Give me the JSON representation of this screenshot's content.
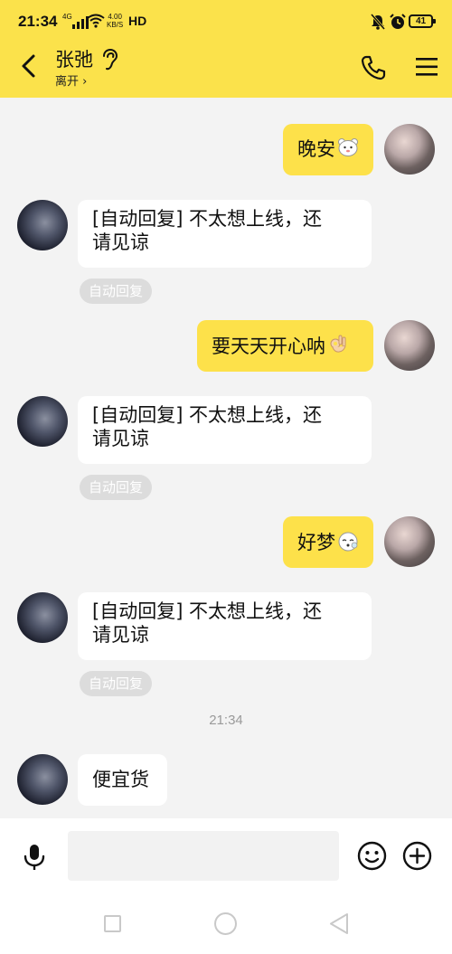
{
  "status_bar": {
    "time": "21:34",
    "network": "4G",
    "speed_value": "4.00",
    "speed_unit": "KB/S",
    "hd": "HD",
    "battery": "41"
  },
  "header": {
    "contact_name": "张弛",
    "contact_status": "离开 ›",
    "icons": [
      "back-arrow-icon",
      "ear-icon",
      "phone-icon",
      "menu-icon"
    ]
  },
  "messages": [
    {
      "side": "me",
      "text": "晚安",
      "emoji": "bear-emoji"
    },
    {
      "side": "them",
      "line1": "[自动回复] 不太想上线，还",
      "line2": "请见谅",
      "tag": "自动回复"
    },
    {
      "side": "me",
      "text": "要天天开心呐",
      "emoji": "ok-hand-emoji"
    },
    {
      "side": "them",
      "line1": "[自动回复] 不太想上线，还",
      "line2": "请见谅",
      "tag": "自动回复"
    },
    {
      "side": "me",
      "text": "好梦",
      "emoji": "sleepy-emoji"
    },
    {
      "side": "them",
      "line1": "[自动回复] 不太想上线，还",
      "line2": "请见谅",
      "tag": "自动回复"
    },
    {
      "timestamp": "21:34"
    },
    {
      "side": "them",
      "text": "便宜货"
    }
  ],
  "input_bar": {
    "placeholder": "",
    "icons": [
      "microphone-icon",
      "smile-icon",
      "plus-icon"
    ]
  },
  "colors": {
    "header_bg": "#fbe24b",
    "my_bubble": "#fde14a",
    "their_bubble": "#ffffff",
    "chat_bg": "#f3f3f3"
  }
}
